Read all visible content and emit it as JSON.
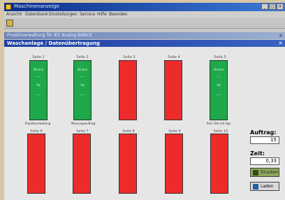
{
  "app": {
    "title": "Maschinenanzeige"
  },
  "menu": [
    "Ansicht",
    "Datenbank",
    "Einstellungen",
    "Service",
    "Hilfe",
    "Beenden"
  ],
  "outer_window": {
    "title": "Projektverwaltung für IEC Analog BANCK"
  },
  "inner_window": {
    "title": "Waschanlage / Datenübertragung"
  },
  "row1": [
    {
      "label": "Seite 1",
      "status": "green",
      "lines": [
        "Dinmix",
        "----",
        "Ag",
        "-----"
      ],
      "caption": "Projektverwaltung"
    },
    {
      "label": "Seite 2",
      "status": "green",
      "lines": [
        "Dinmix",
        "----",
        "Ag",
        "-----"
      ],
      "caption": "Messungsauftrag"
    },
    {
      "label": "Seite 3",
      "status": "red"
    },
    {
      "label": "Seite 4",
      "status": "red"
    },
    {
      "label": "Seite 5",
      "status": "green",
      "lines": [
        "Dinmix",
        "---",
        "Ag",
        "-----"
      ],
      "caption": "Kein Test mit Ags"
    }
  ],
  "row2": [
    {
      "label": "Seite 6",
      "status": "red"
    },
    {
      "label": "Seite 7",
      "status": "red"
    },
    {
      "label": "Seite 8",
      "status": "red"
    },
    {
      "label": "Seite 9",
      "status": "red"
    },
    {
      "label": "Seite 10",
      "status": "red"
    }
  ],
  "panel": {
    "auftrag_label": "Auftrag:",
    "auftrag_value": "15",
    "zeit_label": "Zeit:",
    "zeit_value": "0,33",
    "button1_label": "Drucken",
    "button2_label": "Laden"
  },
  "colors": {
    "ok": "#1fa84a",
    "error": "#ee2b2b",
    "titlebar": "#0b2e8c"
  }
}
